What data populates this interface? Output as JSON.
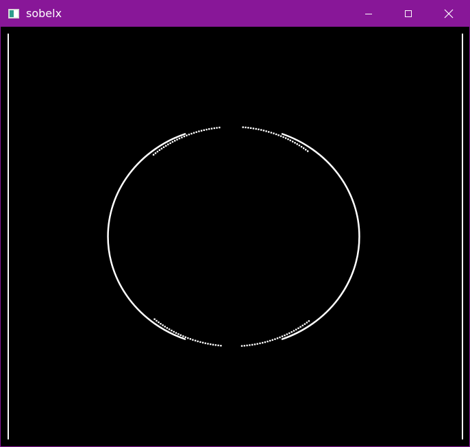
{
  "window": {
    "title": "sobelx",
    "titlebar_color": "#881798",
    "icons": {
      "app": "app-window-icon",
      "minimize": "minimize-icon",
      "maximize": "maximize-icon",
      "close": "close-icon"
    }
  },
  "image": {
    "description_colors": {
      "background": "#000000",
      "edge": "#ffffff"
    }
  }
}
